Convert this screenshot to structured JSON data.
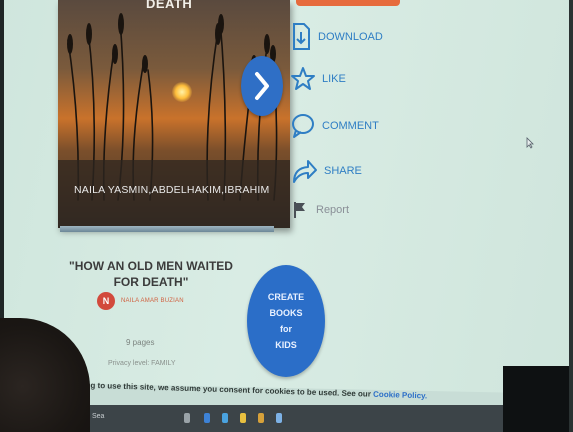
{
  "book": {
    "cover_title": "DEATH",
    "cover_authors": "NAILA YASMIN,ABDELHAKIM,IBRAHIM",
    "title": "\"HOW AN OLD MEN WAITED FOR DEATH\"",
    "author_initial": "N",
    "author_name": "NAILA AMAR BUZIAN",
    "pages": "9 pages",
    "privacy": "Privacy level: FAMILY"
  },
  "actions": {
    "download": "DOWNLOAD",
    "like": "LIKE",
    "comment": "COMMENT",
    "share": "SHARE",
    "report": "Report"
  },
  "create_button": {
    "line1": "CREATE",
    "line2": "BOOKS",
    "line3": "for",
    "line4": "KIDS"
  },
  "cookie": {
    "text": "ntinuing to use this site, we assume you consent for cookies to be used. See our",
    "link": "Cookie Policy."
  },
  "taskbar": {
    "search_label": "Sea"
  },
  "colors": {
    "accent_blue": "#2f7ec4",
    "button_blue": "#2b6ec8",
    "author_red": "#d24a3c",
    "top_strip": "#e66b3d"
  }
}
